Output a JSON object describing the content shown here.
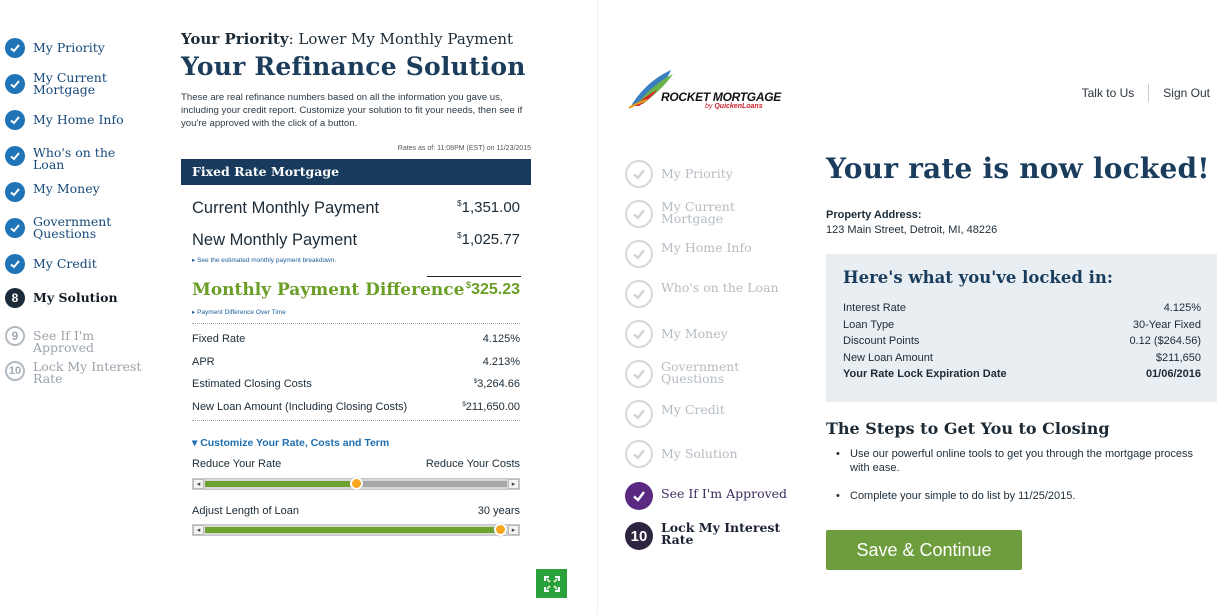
{
  "left": {
    "steps": [
      {
        "label": "My Priority",
        "state": "done"
      },
      {
        "label": "My Current Mortgage",
        "state": "done"
      },
      {
        "label": "My Home Info",
        "state": "done"
      },
      {
        "label": "Who's on the Loan",
        "state": "done"
      },
      {
        "label": "My Money",
        "state": "done"
      },
      {
        "label": "Government Questions",
        "state": "done"
      },
      {
        "label": "My Credit",
        "state": "done"
      },
      {
        "label": "My Solution",
        "state": "current",
        "number": "8"
      },
      {
        "label": "See If I'm Approved",
        "state": "future",
        "number": "9"
      },
      {
        "label": "Lock My Interest Rate",
        "state": "future",
        "number": "10"
      }
    ],
    "priority_prefix": "Your Priority",
    "priority_value": ": Lower My Monthly Payment",
    "title": "Your Refinance Solution",
    "intro": "These are real refinance numbers based on all the information you gave us, including your credit report. Customize your solution to fit your needs, then see if you're approved with the click of a button.",
    "rates_note": "Rates as of: 11:08PM (EST) on 11/23/2015",
    "section_title": "Fixed Rate Mortgage",
    "current_payment_label": "Current Monthly Payment",
    "current_payment_currency": "$",
    "current_payment_value": "1,351.00",
    "new_payment_label": "New Monthly Payment",
    "new_payment_currency": "$",
    "new_payment_value": "1,025.77",
    "breakdown_link": "▸ See the estimated monthly payment breakdown.",
    "difference_label": "Monthly Payment Difference",
    "difference_currency": "$",
    "difference_value": "325.23",
    "difference_link": "▸ Payment Difference Over Time",
    "details": [
      {
        "label": "Fixed Rate",
        "currency": "",
        "value": "4.125%"
      },
      {
        "label": "APR",
        "currency": "",
        "value": "4.213%"
      },
      {
        "label": "Estimated Closing Costs",
        "currency": "$",
        "value": "3,264.66"
      },
      {
        "label": "New Loan Amount (Including Closing Costs)",
        "currency": "$",
        "value": "211,650.00"
      }
    ],
    "customize_label": "▾ Customize Your Rate, Costs and Term",
    "slider1_left": "Reduce Your Rate",
    "slider1_right": "Reduce Your Costs",
    "slider1_fraction": 0.5,
    "slider2_left": "Adjust Length of Loan",
    "slider2_right": "30 years",
    "slider2_fraction": 1.0
  },
  "right": {
    "logo_text": "ROCKET MORTGAGE",
    "logo_by": "by",
    "logo_brand": "QuickenLoans",
    "links": [
      "Talk to Us",
      "Sign Out"
    ],
    "steps": [
      {
        "label": "My Priority",
        "state": "faded"
      },
      {
        "label": "My Current Mortgage",
        "state": "faded"
      },
      {
        "label": "My Home Info",
        "state": "faded"
      },
      {
        "label": "Who's on the Loan",
        "state": "faded"
      },
      {
        "label": "My Money",
        "state": "faded"
      },
      {
        "label": "Government Questions",
        "state": "faded"
      },
      {
        "label": "My Credit",
        "state": "faded"
      },
      {
        "label": "My Solution",
        "state": "faded"
      },
      {
        "label": "See If I'm Approved",
        "state": "approved"
      },
      {
        "label": "Lock My Interest Rate",
        "state": "current",
        "number": "10"
      }
    ],
    "title": "Your rate is now locked!",
    "property_label": "Property Address:",
    "property_value": "123 Main Street, Detroit, MI, 48226",
    "box_title": "Here's what you've locked in:",
    "locked": [
      {
        "label": "Interest Rate",
        "value": "4.125%"
      },
      {
        "label": "Loan Type",
        "value": "30-Year Fixed"
      },
      {
        "label": "Discount Points",
        "value": "0.12 ($264.56)"
      },
      {
        "label": "New Loan Amount",
        "value": "$211,650"
      },
      {
        "label": "Your Rate Lock Expiration Date",
        "value": "01/06/2016"
      }
    ],
    "steps_title": "The Steps to Get You to Closing",
    "bullets": [
      "Use our powerful online tools to get you through the mortgage process with ease.",
      "Complete your simple to do list by 11/25/2015."
    ],
    "button": "Save & Continue"
  },
  "colors": {
    "navy": "#1a3d5e",
    "green": "#6a9e27",
    "check_blue": "#1f73b7",
    "purple": "#5a2a82"
  }
}
